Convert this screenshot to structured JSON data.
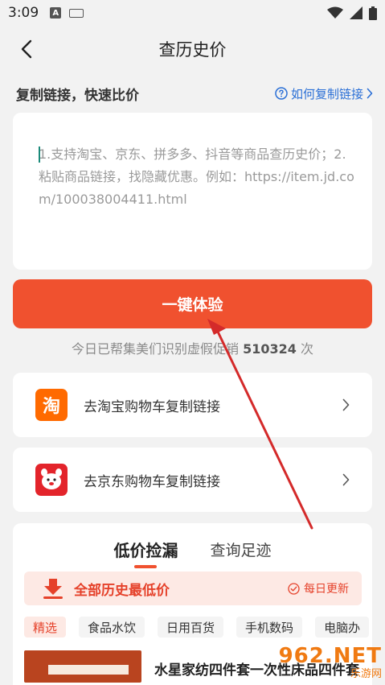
{
  "status_bar": {
    "time": "3:09",
    "badge_letter": "A"
  },
  "nav": {
    "title": "查历史价"
  },
  "section": {
    "title": "复制链接，快速比价",
    "howto_label": "如何复制链接"
  },
  "paste_box": {
    "placeholder": "1.支持淘宝、京东、拼多多、抖音等商品查历史价；2.粘贴商品链接，找隐藏优惠。例如：https://item.jd.com/100038004411.html"
  },
  "cta": {
    "label": "一键体验"
  },
  "stats": {
    "prefix": "今日已帮集美们识别虚假促销",
    "count": "510324",
    "suffix": "次"
  },
  "shortcuts": [
    {
      "logo_text": "淘",
      "label": "去淘宝购物车复制链接"
    },
    {
      "logo_text": "",
      "label": "去京东购物车复制链接"
    }
  ],
  "deals": {
    "tabs": [
      {
        "label": "低价捡漏"
      },
      {
        "label": "查询足迹"
      }
    ],
    "banner_title": "全部历史最低价",
    "banner_right": "每日更新",
    "categories": [
      "精选",
      "食品水饮",
      "日用百货",
      "手机数码",
      "电脑办"
    ],
    "product_name": "水星家纺四件套一次性床品四件套"
  },
  "watermark": {
    "number": "962.NET",
    "text": "乐游网"
  },
  "colors": {
    "accent": "#f0512f",
    "link": "#2a6fd6",
    "banner_bg": "#fde9e4"
  }
}
